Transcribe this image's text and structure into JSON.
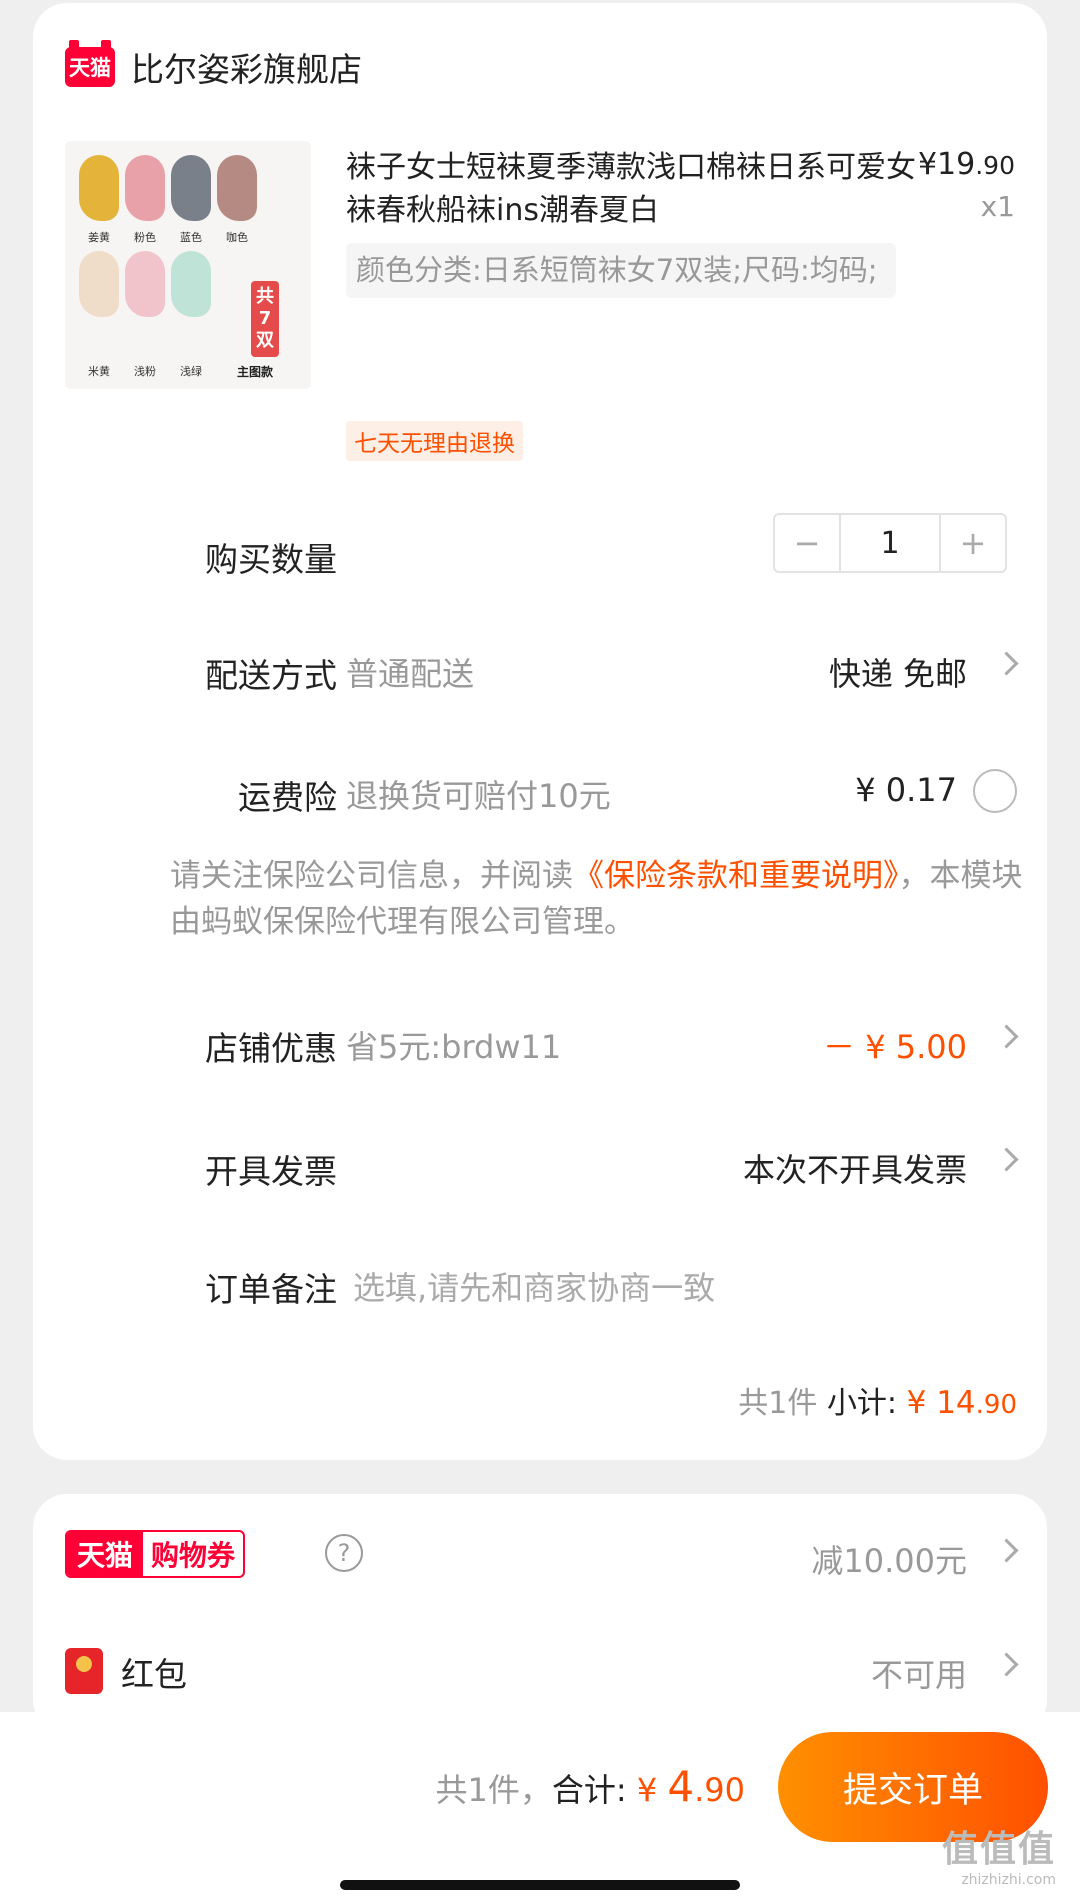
{
  "shop": {
    "logo_text": "天猫",
    "name": "比尔姿彩旗舰店"
  },
  "product": {
    "title": "袜子女士短袜夏季薄款浅口棉袜日系可爱女袜春秋船袜ins潮春夏白",
    "price_symbol": "¥",
    "price_int": "19",
    "price_dec": ".90",
    "quantity_mark": "x1",
    "sku": "颜色分类:日系短筒袜女7双装;尺码:均码;",
    "badge": "七天无理由退换",
    "thumb": {
      "labels": [
        "姜黄",
        "粉色",
        "蓝色",
        "咖色",
        "米黄",
        "浅粉",
        "浅绿"
      ],
      "pack_tag": [
        "共",
        "7",
        "双"
      ],
      "pack_main": "主图款",
      "colors": [
        "#e3b33a",
        "#e8a1a8",
        "#7a8089",
        "#b58a82",
        "#efdcc9",
        "#f1c4cc",
        "#bfe3d7"
      ]
    }
  },
  "quantity": {
    "label": "购买数量",
    "minus": "−",
    "value": "1",
    "plus": "+"
  },
  "delivery": {
    "label": "配送方式",
    "sub": "普通配送",
    "value": "快递 免邮"
  },
  "insurance": {
    "label": "运费险",
    "sub": "退换货可赔付10元",
    "value": "¥ 0.17"
  },
  "notice": {
    "prefix": "请关注保险公司信息，并阅读",
    "link": "《保险条款和重要说明》",
    "suffix": "，本模块由蚂蚁保保险代理有限公司管理。"
  },
  "shop_discount": {
    "label": "店铺优惠",
    "sub": "省5元:brdw11",
    "value": "－ ¥ 5.00"
  },
  "invoice": {
    "label": "开具发票",
    "value": "本次不开具发票"
  },
  "remark": {
    "label": "订单备注",
    "placeholder": "选填,请先和商家协商一致"
  },
  "subtotal": {
    "count": "共1件",
    "label": "小计:",
    "symbol": "¥",
    "int": "14",
    "dec": ".90"
  },
  "coupon": {
    "logo_a": "天猫",
    "logo_b": "购物券",
    "help": "?",
    "value": "减10.00元"
  },
  "red_packet": {
    "label": "红包",
    "value": "不可用"
  },
  "footer": {
    "count": "共1件，",
    "label": "合计:",
    "symbol": "¥ ",
    "int": "4",
    "dec": ".90",
    "submit": "提交订单",
    "watermark": "值值值",
    "watermark_sub": "zhizhizhi.com"
  }
}
